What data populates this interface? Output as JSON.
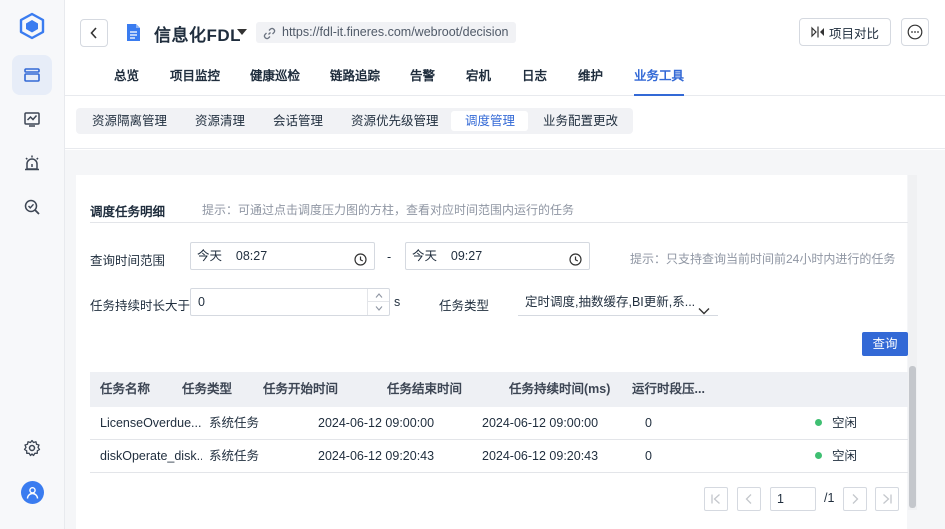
{
  "header": {
    "project_name": "信息化FDL",
    "url": "https://fdl-it.fineres.com/webroot/decision",
    "compare_label": "项目对比"
  },
  "nav": {
    "tabs": [
      "总览",
      "项目监控",
      "健康巡检",
      "链路追踪",
      "告警",
      "宕机",
      "日志",
      "维护",
      "业务工具"
    ],
    "active": "业务工具"
  },
  "subtabs": {
    "items": [
      "资源隔离管理",
      "资源清理",
      "会话管理",
      "资源优先级管理",
      "调度管理",
      "业务配置更改"
    ],
    "active": "调度管理"
  },
  "section": {
    "title": "调度任务明细",
    "tip": "提示：可通过点击调度压力图的方柱，查看对应时间范围内运行的任务"
  },
  "filters": {
    "time_range_label": "查询时间范围",
    "start_value": "今天    08:27",
    "separator": "-",
    "end_value": "今天    09:27",
    "time_tip": "提示：只支持查询当前时间前24小时内进行的任务",
    "duration_label": "任务持续时长大于",
    "duration_value": "0",
    "duration_unit": "s",
    "task_type_label": "任务类型",
    "task_type_value": "定时调度,抽数缓存,BI更新,系...",
    "query_label": "查询"
  },
  "table": {
    "columns": [
      "任务名称",
      "任务类型",
      "任务开始时间",
      "任务结束时间",
      "任务持续时间(ms)",
      "运行时段压..."
    ],
    "rows": [
      {
        "name": "LicenseOverdue...",
        "type": "系统任务",
        "start": "2024-06-12 09:00:00",
        "end": "2024-06-12 09:00:00",
        "duration": "0",
        "status": "空闲"
      },
      {
        "name": "diskOperate_disk...",
        "type": "系统任务",
        "start": "2024-06-12 09:20:43",
        "end": "2024-06-12 09:20:43",
        "duration": "0",
        "status": "空闲"
      }
    ]
  },
  "pagination": {
    "current": "1",
    "total": "/1"
  },
  "colors": {
    "accent": "#3369d6",
    "status_idle": "#3fbf72"
  }
}
